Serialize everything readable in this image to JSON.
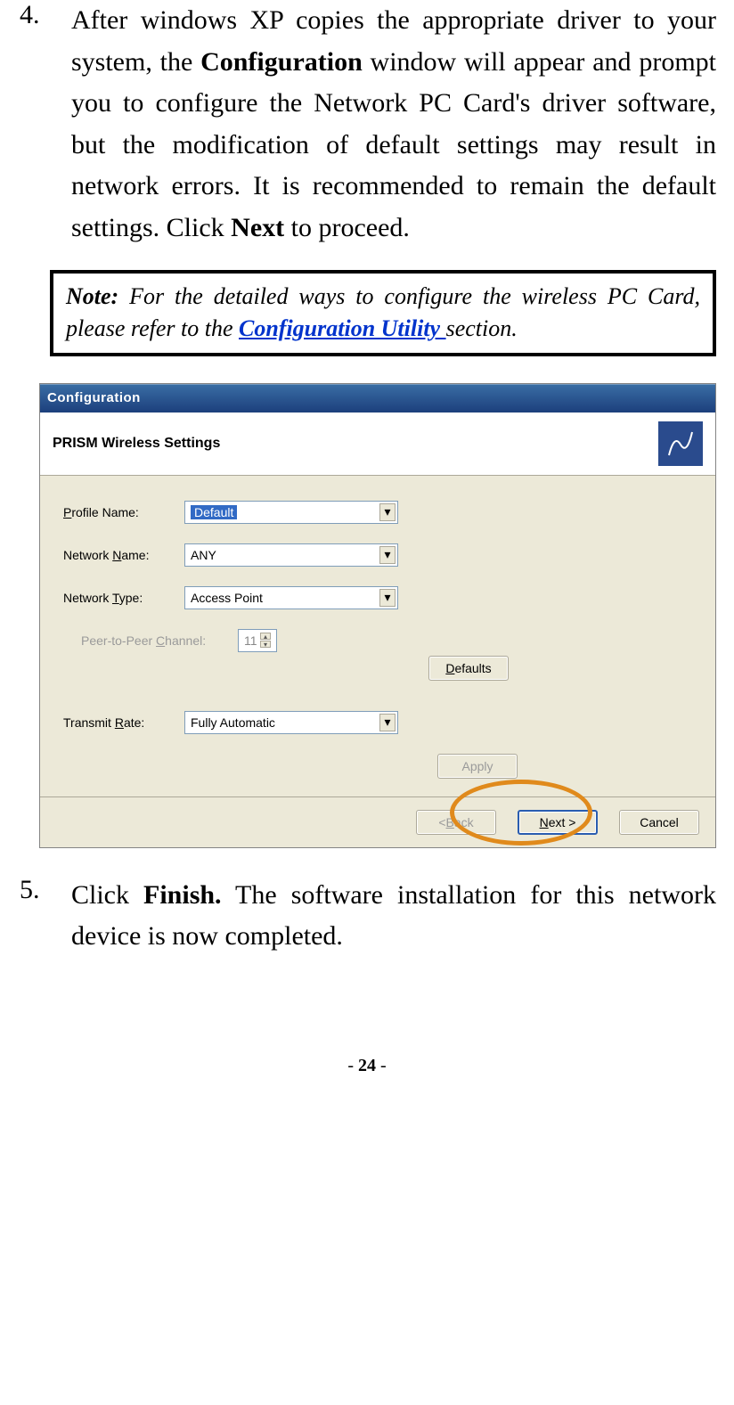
{
  "steps": {
    "s4": {
      "num": "4.",
      "text_before_bold": "After windows XP copies the appropriate driver to your system, the ",
      "bold1": "Configuration",
      "text_mid": " window will appear and prompt you to configure the Network PC Card's driver software, but the modification of default settings may result in network errors.   It is recommended to remain the default settings. Click ",
      "bold2": "Next",
      "text_after": " to proceed."
    },
    "s5": {
      "num": "5.",
      "text_before_bold": "Click ",
      "bold1": "Finish.",
      "text_after": "   The software installation for this network device is now completed."
    }
  },
  "note": {
    "label": "Note:",
    "text_before_link": " For the detailed ways to configure the wireless PC Card, please refer to the ",
    "link_text": "Configuration Utility ",
    "text_after_link": "section."
  },
  "dialog": {
    "title": "Configuration",
    "header": "PRISM Wireless Settings",
    "fields": {
      "profile_label": "Profile Name:",
      "profile_value": "Default",
      "network_name_label": "Network Name:",
      "network_name_value": "ANY",
      "network_type_label": "Network Type:",
      "network_type_value": "Access Point",
      "p2p_label": "Peer-to-Peer Channel:",
      "p2p_value": "11",
      "transmit_label": "Transmit Rate:",
      "transmit_value": "Fully Automatic"
    },
    "buttons": {
      "defaults": "Defaults",
      "apply": "Apply",
      "back": "< Back",
      "next": "Next >",
      "cancel": "Cancel"
    }
  },
  "footer": {
    "prefix": "- ",
    "page": "24",
    "suffix": " -"
  }
}
